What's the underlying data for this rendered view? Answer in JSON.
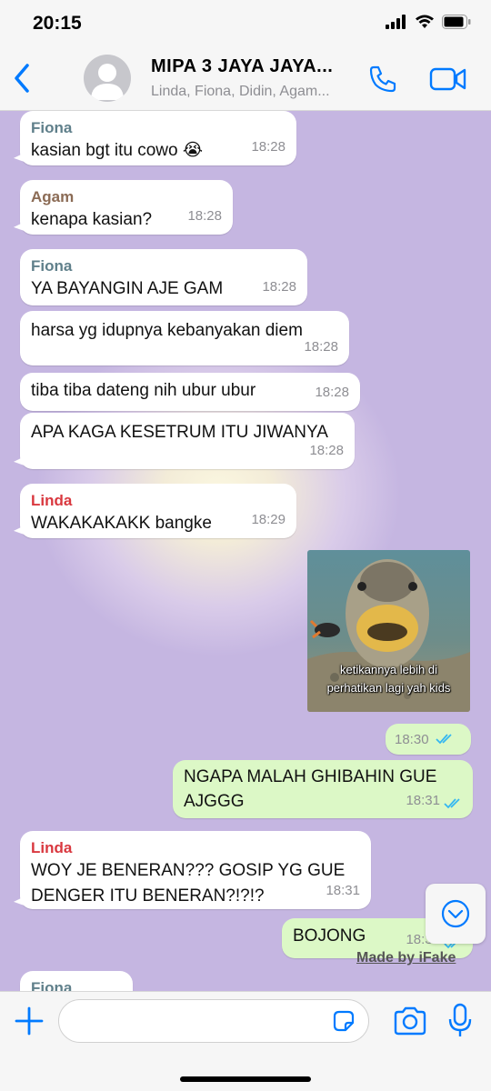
{
  "status": {
    "time": "20:15"
  },
  "header": {
    "title": "MIPA 3 JAYA JAYA...",
    "subtitle": "Linda, Fiona, Didin, Agam..."
  },
  "colors": {
    "accent": "#007aff",
    "fiona": "#5f7f8a",
    "agam": "#8b6b55",
    "linda": "#d9383f",
    "out_bubble": "#dcf8c6"
  },
  "messages": [
    {
      "sender": "Fiona",
      "text": "kasian bgt itu cowo 😭",
      "time": "18:28"
    },
    {
      "sender": "Agam",
      "text": "kenapa kasian?",
      "time": "18:28"
    },
    {
      "sender": "Fiona",
      "text": "YA BAYANGIN AJE GAM",
      "time": "18:28"
    },
    {
      "text": "harsa yg idupnya kebanyakan diem",
      "time": "18:28"
    },
    {
      "text": "tiba tiba dateng nih ubur ubur",
      "time": "18:28"
    },
    {
      "text": "APA KAGA KESETRUM ITU JIWANYA",
      "time": "18:28"
    },
    {
      "sender": "Linda",
      "text": "WAKAKAKAKK bangke",
      "time": "18:29"
    },
    {
      "image_caption_1": "ketikannya lebih di",
      "image_caption_2": "perhatikan lagi yah kids",
      "time": "18:30"
    },
    {
      "text_1": "NGAPA MALAH GHIBAHIN GUE",
      "text_2": "AJGGG",
      "time": "18:31"
    },
    {
      "sender": "Linda",
      "text_1": "WOY JE BENERAN??? GOSIP YG GUE",
      "text_2": "DENGER ITU BENERAN?!?!?",
      "time": "18:31"
    },
    {
      "text": "BOJONG",
      "time": "18:31"
    },
    {
      "sender": "Fiona"
    }
  ],
  "watermark": "Made by iFake",
  "input": {
    "placeholder": ""
  },
  "icons": [
    "back-chevron-icon",
    "group-avatar-icon",
    "phone-icon",
    "video-camera-icon",
    "plus-icon",
    "sticker-icon",
    "camera-icon",
    "microphone-icon",
    "chevron-down-icon",
    "double-check-icon"
  ]
}
